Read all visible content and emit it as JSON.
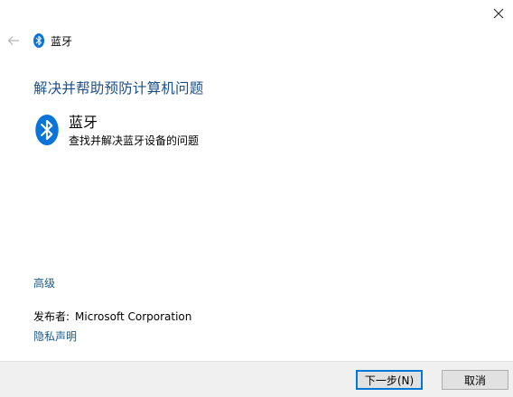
{
  "window": {
    "header_title": "蓝牙"
  },
  "main": {
    "heading": "解决并帮助预防计算机问题",
    "option": {
      "title": "蓝牙",
      "description": "查找并解决蓝牙设备的问题"
    }
  },
  "links": {
    "advanced": "高级",
    "privacy": "隐私声明"
  },
  "publisher": {
    "label": "发布者:",
    "name": "Microsoft Corporation"
  },
  "footer": {
    "next_label": "下一步(N)",
    "cancel_label": "取消"
  },
  "colors": {
    "accent": "#0078d7",
    "heading": "#1b4f8a",
    "link": "#1a5a8c",
    "bluetooth_blue": "#0a74da"
  },
  "icons": {
    "close": "close-icon",
    "back": "back-arrow-icon",
    "bluetooth": "bluetooth-icon"
  }
}
